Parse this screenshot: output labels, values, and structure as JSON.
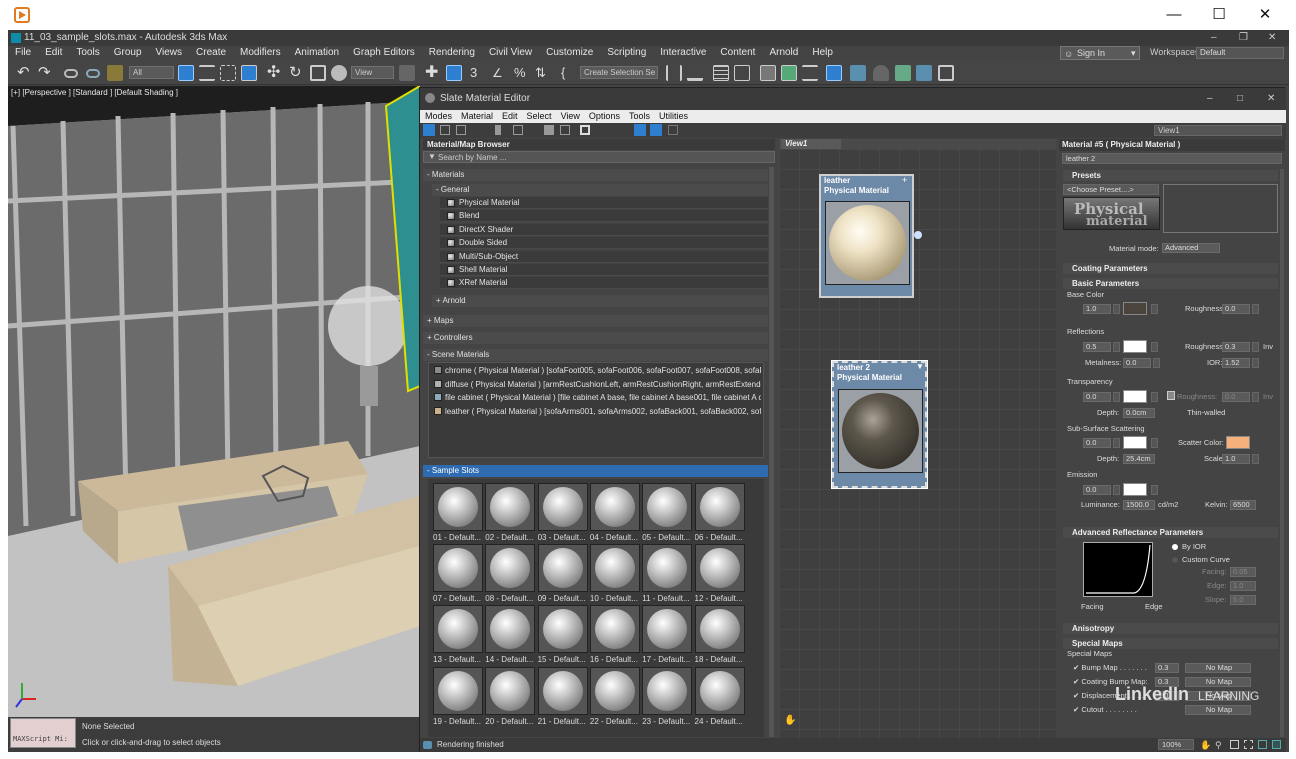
{
  "window": {
    "title": "11_03_sample_slots.max - Autodesk 3ds Max"
  },
  "menu": [
    "File",
    "Edit",
    "Tools",
    "Group",
    "Views",
    "Create",
    "Modifiers",
    "Animation",
    "Graph Editors",
    "Rendering",
    "Civil View",
    "Customize",
    "Scripting",
    "Interactive",
    "Content",
    "Arnold",
    "Help"
  ],
  "account": {
    "signin": "Sign In",
    "workspaces_label": "Workspaces:",
    "workspace": "Default"
  },
  "toolbar": {
    "filter": "All",
    "view_select": "View",
    "selection_set": "Create Selection Se"
  },
  "viewport": {
    "label": "[+] [Perspective ] [Standard ] [Default Shading ]"
  },
  "status": {
    "maxscript": "MAXScript Mi:",
    "selection": "None Selected",
    "prompt": "Click or click-and-drag to select objects"
  },
  "slate": {
    "title": "Slate Material Editor",
    "menu": [
      "Modes",
      "Material",
      "Edit",
      "Select",
      "View",
      "Options",
      "Tools",
      "Utilities"
    ],
    "view_tab": "View1",
    "view_select": "View1",
    "status": "Rendering finished",
    "zoom": "100%"
  },
  "browser": {
    "title": "Material/Map Browser",
    "search_placeholder": "Search by Name ...",
    "cat_materials": "- Materials",
    "cat_general": "- General",
    "general": [
      "Physical Material",
      "Blend",
      "DirectX Shader",
      "Double Sided",
      "Multi/Sub-Object",
      "Shell Material",
      "XRef Material"
    ],
    "cat_arnold": "+ Arnold",
    "cat_maps": "+ Maps",
    "cat_controllers": "+ Controllers",
    "cat_scene": "- Scene Materials",
    "scene": [
      "chrome  ( Physical Material ) [sofaFoot005, sofaFoot006, sofaFoot007, sofaFoot008, sofaFo...",
      "diffuse  ( Physical Material ) [armRestCushionLeft, armRestCushionRight, armRestExtender...",
      "file cabinet  ( Physical Material ) [file cabinet A base, file cabinet A base001, file cabinet A d...",
      "leather  ( Physical Material ) [sofaArms001, sofaArms002, sofaBack001, sofaBack002, sofaB..."
    ],
    "scene_colors": [
      "#8a8a8a",
      "#b0b0b0",
      "#8fa9b8",
      "#c9b28a"
    ],
    "cat_slots": "- Sample Slots",
    "slots": [
      "01 - Default...",
      "02 - Default...",
      "03 - Default...",
      "04 - Default...",
      "05 - Default...",
      "06 - Default...",
      "07 - Default...",
      "08 - Default...",
      "09 - Default...",
      "10 - Default...",
      "11 - Default...",
      "12 - Default...",
      "13 - Default...",
      "14 - Default...",
      "15 - Default...",
      "16 - Default...",
      "17 - Default...",
      "18 - Default...",
      "19 - Default...",
      "20 - Default...",
      "21 - Default...",
      "22 - Default...",
      "23 - Default...",
      "24 - Default..."
    ]
  },
  "nodes": [
    {
      "name": "leather",
      "type": "Physical Material"
    },
    {
      "name": "leather 2",
      "type": "Physical Material"
    }
  ],
  "params": {
    "header": "Material #5  ( Physical Material )",
    "name": "leather 2",
    "presets": "Presets",
    "choose_preset": "<Choose Preset....>",
    "logo_line1": "Physical",
    "logo_line2": "material",
    "material_mode_label": "Material mode:",
    "material_mode": "Advanced",
    "coating": "Coating Parameters",
    "basic": "Basic Parameters",
    "base_color": "Base Color",
    "base_weight": "1.0",
    "roughness_label": "Roughness:",
    "base_roughness": "0.0",
    "reflections": "Reflections",
    "refl_weight": "0.5",
    "refl_roughness": "0.3",
    "inv": "Inv",
    "metalness_label": "Metalness:",
    "metalness": "0.0",
    "ior_label": "IOR:",
    "ior": "1.52",
    "transparency": "Transparency",
    "trans_weight": "0.0",
    "trans_roughness": "0.0",
    "depth_label": "Depth:",
    "trans_depth": "0.0cm",
    "thin_walled": "Thin-walled",
    "sss": "Sub-Surface Scattering",
    "sss_weight": "0.0",
    "scatter_label": "Scatter Color:",
    "sss_depth": "25.4cm",
    "scale_label": "Scale:",
    "sss_scale": "1.0",
    "emission": "Emission",
    "emission_weight": "0.0",
    "luminance_label": "Luminance:",
    "luminance": "1500.0",
    "luminance_unit": "cd/m2",
    "kelvin_label": "Kelvin:",
    "kelvin": "6500",
    "advanced_refl": "Advanced Reflectance Parameters",
    "by_ior": "By IOR",
    "custom_curve": "Custom Curve",
    "facing_label": "Facing:",
    "facing": "0.05",
    "edge_label": "Edge:",
    "edge": "1.0",
    "slope_label": "Slope:",
    "slope": "5.0",
    "curve_facing": "Facing",
    "curve_edge": "Edge",
    "anisotropy": "Anisotropy",
    "special_maps": "Special Maps",
    "special_maps_sub": "Special Maps",
    "bump_map": "Bump Map . . . . . . .",
    "bump_val": "0.3",
    "coating_bump": "Coating Bump Map:",
    "coating_bump_val": "0.3",
    "displacement": "Displacement . . . .",
    "displacement_val": "1.0",
    "cutout": "Cutout . . . . . . . .",
    "no_map": "No Map"
  },
  "colors": {
    "base_color": "#4a443c",
    "refl_color": "#ffffff",
    "trans_color": "#ffffff",
    "sss_color": "#ffffff",
    "scatter_color": "#f6b07c",
    "emission_color": "#ffffff"
  },
  "watermark": {
    "brand": "LinkedIn",
    "learning": "LEARNING"
  }
}
